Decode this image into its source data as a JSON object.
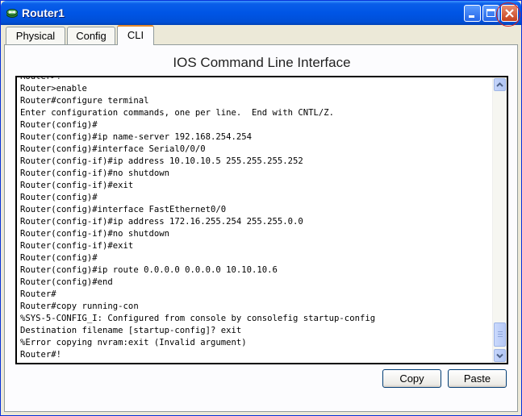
{
  "window": {
    "title": "Router1"
  },
  "tabs": [
    {
      "label": "Physical",
      "active": false
    },
    {
      "label": "Config",
      "active": false
    },
    {
      "label": "CLI",
      "active": true
    }
  ],
  "cli": {
    "heading": "IOS Command Line Interface",
    "lines": [
      "Router>!",
      "Router>enable",
      "Router#configure terminal",
      "Enter configuration commands, one per line.  End with CNTL/Z.",
      "Router(config)#",
      "Router(config)#ip name-server 192.168.254.254",
      "Router(config)#interface Serial0/0/0",
      "Router(config-if)#ip address 10.10.10.5 255.255.255.252",
      "Router(config-if)#no shutdown",
      "Router(config-if)#exit",
      "Router(config)#",
      "Router(config)#interface FastEthernet0/0",
      "Router(config-if)#ip address 172.16.255.254 255.255.0.0",
      "Router(config-if)#no shutdown",
      "Router(config-if)#exit",
      "Router(config)#",
      "Router(config)#ip route 0.0.0.0 0.0.0.0 10.10.10.6",
      "Router(config)#end",
      "Router#",
      "Router#copy running-con",
      "%SYS-5-CONFIG_I: Configured from console by consolefig startup-config",
      "Destination filename [startup-config]? exit",
      "%Error copying nvram:exit (Invalid argument)",
      "Router#!"
    ]
  },
  "buttons": {
    "copy_label": "Copy",
    "paste_label": "Paste"
  },
  "colors": {
    "titlebar": "#0055e5",
    "window_bg": "#ece9d8",
    "active_tab_accent": "#e68b2c",
    "close_highlight": "#d62020"
  }
}
